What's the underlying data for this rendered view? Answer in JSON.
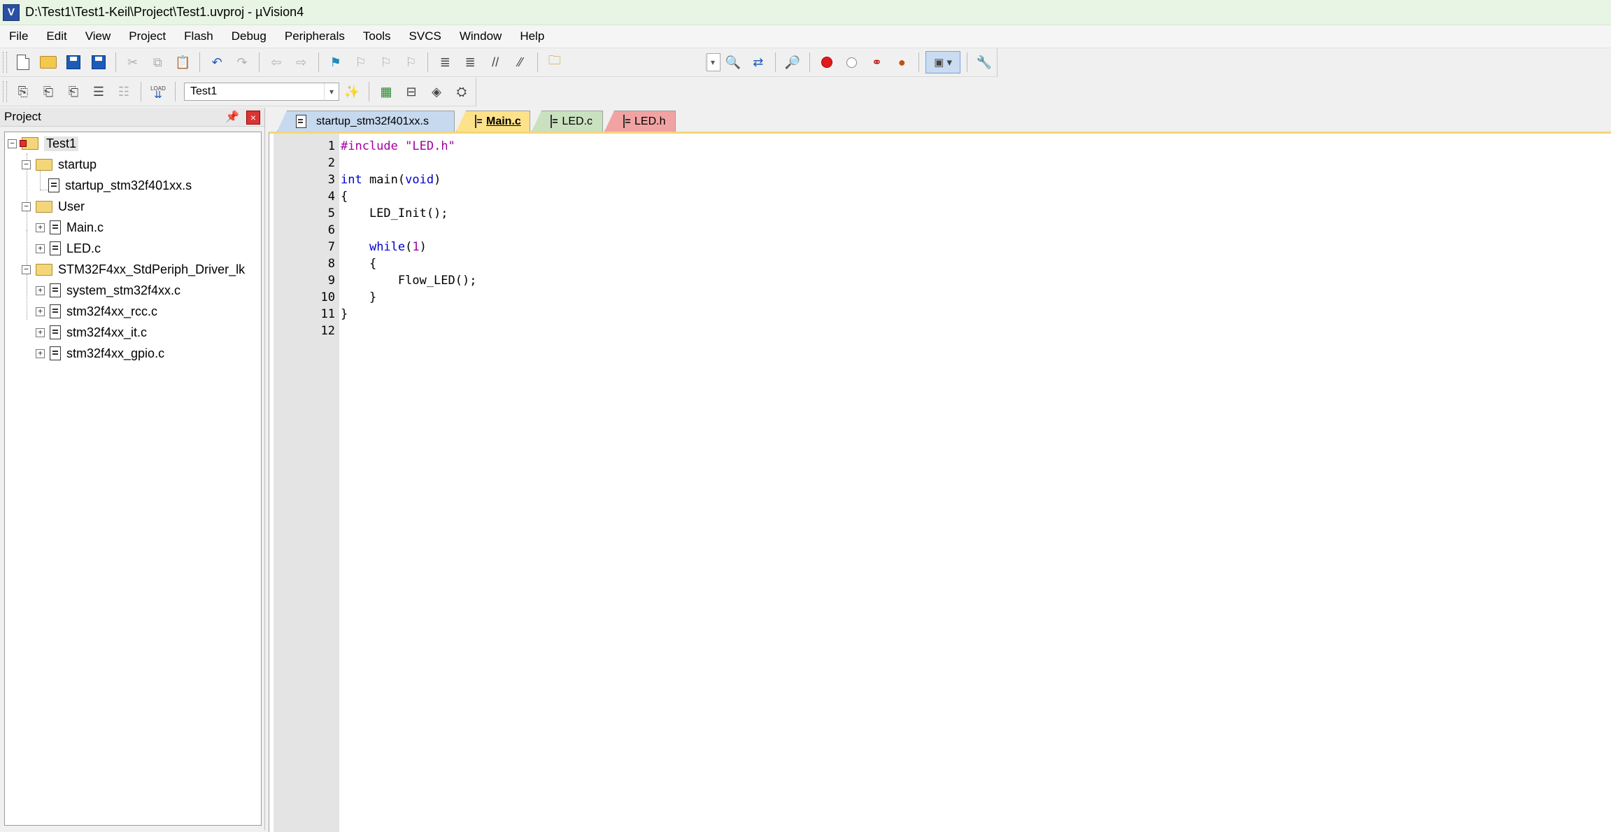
{
  "window": {
    "title": "D:\\Test1\\Test1-Keil\\Project\\Test1.uvproj - µVision4",
    "app_icon": "V"
  },
  "menu": [
    "File",
    "Edit",
    "View",
    "Project",
    "Flash",
    "Debug",
    "Peripherals",
    "Tools",
    "SVCS",
    "Window",
    "Help"
  ],
  "toolbar2": {
    "load_label": "LOAD",
    "target": "Test1"
  },
  "project_panel": {
    "title": "Project",
    "root": "Test1",
    "groups": [
      {
        "name": "startup",
        "files": [
          "startup_stm32f401xx.s"
        ]
      },
      {
        "name": "User",
        "files": [
          "Main.c",
          "LED.c"
        ]
      },
      {
        "name": "STM32F4xx_StdPeriph_Driver_lk",
        "files": [
          "system_stm32f4xx.c",
          "stm32f4xx_rcc.c",
          "stm32f4xx_it.c",
          "stm32f4xx_gpio.c"
        ]
      }
    ]
  },
  "tabs": [
    {
      "label": "startup_stm32f401xx.s",
      "color": "#c6d9ee"
    },
    {
      "label": "Main.c",
      "color": "#fde28a",
      "active": true
    },
    {
      "label": "LED.c",
      "color": "#c9e1bf"
    },
    {
      "label": "LED.h",
      "color": "#f1a3a3"
    }
  ],
  "code": {
    "line_numbers": [
      "1",
      "2",
      "3",
      "4",
      "5",
      "6",
      "7",
      "8",
      "9",
      "10",
      "11",
      "12"
    ],
    "l1_directive": "#include",
    "l1_string": "\"LED.h\"",
    "l3_kw": "int",
    "l3_mid": " main(",
    "l3_void": "void",
    "l3_end": ")",
    "l4": "{",
    "l5": "    LED_Init();",
    "l7_indent": "    ",
    "l7_kw": "while",
    "l7_open": "(",
    "l7_num": "1",
    "l7_close": ")",
    "l8": "    {",
    "l9": "        Flow_LED();",
    "l10": "    }",
    "l11": "}"
  }
}
